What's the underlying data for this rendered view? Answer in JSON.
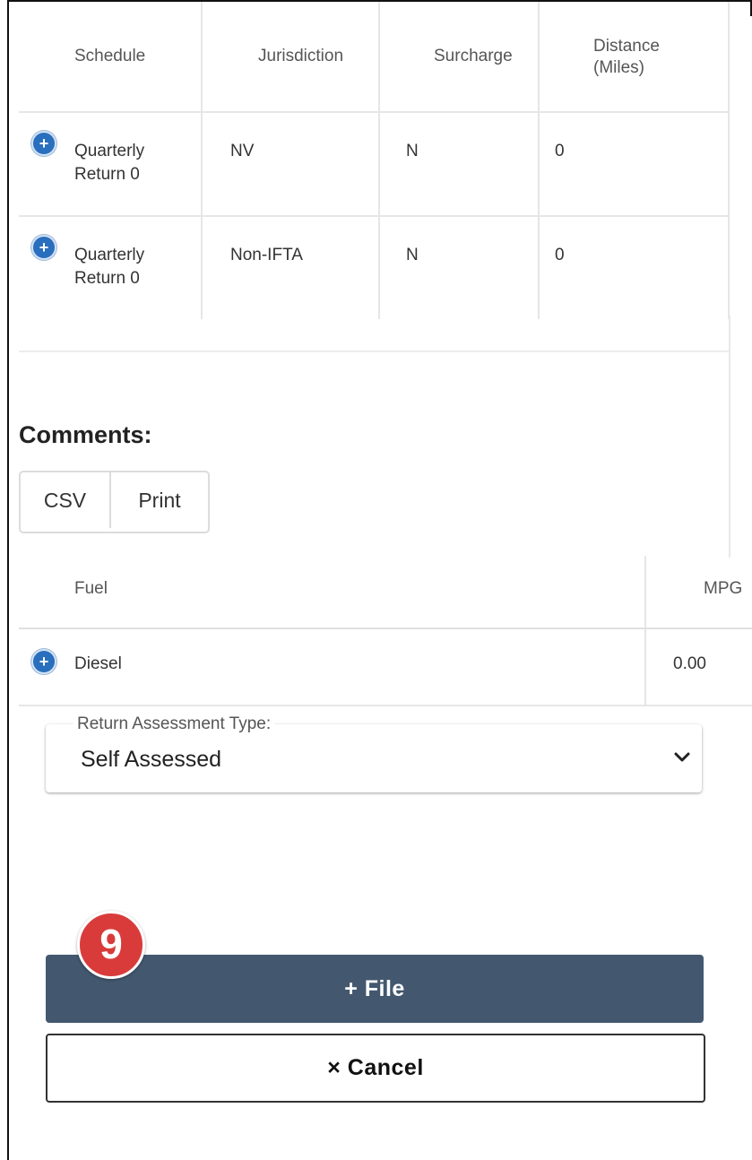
{
  "schedule_table": {
    "headers": {
      "schedule": "Schedule",
      "jurisdiction": "Jurisdiction",
      "surcharge": "Surcharge",
      "distance_line1": "Distance",
      "distance_line2": "(Miles)"
    },
    "rows": [
      {
        "expand_icon": "+",
        "schedule_line1": "Quarterly",
        "schedule_line2": "Return 0",
        "jurisdiction": "NV",
        "surcharge": "N",
        "distance": "0"
      },
      {
        "expand_icon": "+",
        "schedule_line1": "Quarterly",
        "schedule_line2": "Return 0",
        "jurisdiction": "Non-IFTA",
        "surcharge": "N",
        "distance": "0"
      }
    ]
  },
  "comments": {
    "label": "Comments:"
  },
  "export_buttons": {
    "csv": "CSV",
    "print": "Print"
  },
  "fuel_table": {
    "headers": {
      "fuel": "Fuel",
      "mpg": "MPG"
    },
    "rows": [
      {
        "expand_icon": "+",
        "fuel": "Diesel",
        "mpg": "0.00"
      }
    ]
  },
  "assessment_select": {
    "label": "Return Assessment Type:",
    "value": "Self Assessed",
    "icon": "chevron-down-icon"
  },
  "actions": {
    "file_label": "+ File",
    "cancel_label": "× Cancel"
  },
  "step_badge": {
    "number": "9",
    "color": "#d93b3b"
  },
  "colors": {
    "primary_button": "#43586f",
    "expand_icon": "#2a6fbd"
  }
}
